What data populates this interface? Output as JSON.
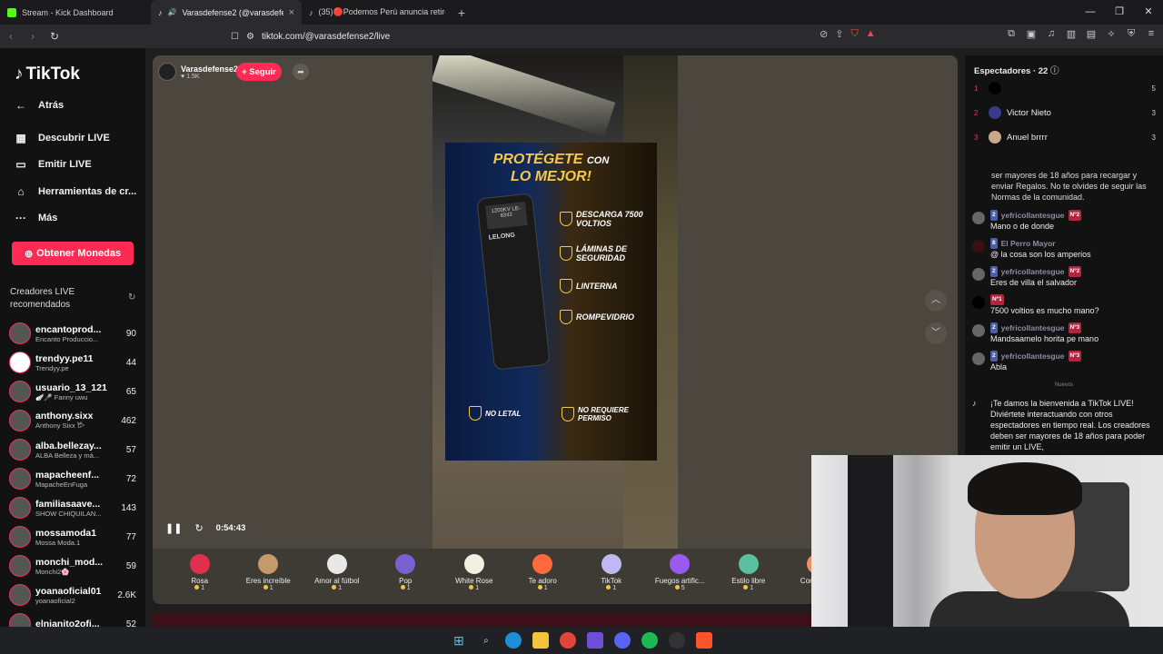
{
  "browser": {
    "tabs": [
      {
        "title": "Stream - Kick Dashboard",
        "color": "#53fc18"
      },
      {
        "title": "Varasdefense2 (@varasdefen...",
        "color": "#ffffff"
      },
      {
        "title": "(35)🔴Podemos Perú anuncia retiro c...",
        "color": "#ffffff"
      }
    ],
    "url": "tiktok.com/@varasdefense2/live"
  },
  "sidebar": {
    "logo": "TikTok",
    "items": [
      {
        "label": "Atrás",
        "icon": "←"
      },
      {
        "label": "Descubrir LIVE",
        "icon": "▦"
      },
      {
        "label": "Emitir LIVE",
        "icon": "▭"
      },
      {
        "label": "Herramientas de cr...",
        "icon": "⌂"
      },
      {
        "label": "Más",
        "icon": "···"
      }
    ],
    "coins_button": "Obtener Monedas",
    "recommended_title": "Creadores LIVE recomendados",
    "creators": [
      {
        "name": "encantoprod...",
        "sub": "Encanto Produccio...",
        "count": "90"
      },
      {
        "name": "trendyy.pe11",
        "sub": "Trendyy.pe",
        "count": "44"
      },
      {
        "name": "usuario_13_121",
        "sub": "🪽🎤 Fanny uwu",
        "count": "65"
      },
      {
        "name": "anthony.sixx",
        "sub": "Anthony Sixx 𐂂",
        "count": "462"
      },
      {
        "name": "alba.bellezay...",
        "sub": "ALBA Belleza y má...",
        "count": "57"
      },
      {
        "name": "mapacheenf...",
        "sub": "MapacheEnFuga",
        "count": "72"
      },
      {
        "name": "familiasaave...",
        "sub": "SHOW CHIQUILAN...",
        "count": "143"
      },
      {
        "name": "mossamoda1",
        "sub": "Mossa Moda.1",
        "count": "77"
      },
      {
        "name": "monchi_mod...",
        "sub": "Monchi2🌸",
        "count": "59"
      },
      {
        "name": "yoanaoficial01",
        "sub": "yoanaoficial2",
        "count": "2.6K"
      },
      {
        "name": "elnianito2ofi...",
        "sub": "",
        "count": "52"
      }
    ]
  },
  "stream": {
    "host_name": "Varasdefense2",
    "host_likes": "1.5K",
    "follow_label": "+ Seguir",
    "elapsed": "0:54:43",
    "ad": {
      "title1": "PROTÉGETE",
      "title1b": "CON",
      "title2": "LO MEJOR!",
      "device_model": "1200KV LE-8342",
      "brand": "LELONG",
      "features": [
        "DESCARGA 7500 VOLTIOS",
        "LÁMINAS DE SEGURIDAD",
        "LINTERNA",
        "ROMPEVIDRIO"
      ],
      "badges": [
        "NO LETAL",
        "NO REQUIERE PERMISO"
      ]
    },
    "gifts": [
      {
        "name": "Rosa",
        "price": "1",
        "color": "#e0304e"
      },
      {
        "name": "Eres increíble",
        "price": "1",
        "color": "#c49a6c"
      },
      {
        "name": "Amor al fútbol",
        "price": "1",
        "color": "#e8e8e8"
      },
      {
        "name": "Pop",
        "price": "1",
        "color": "#7a5fd0"
      },
      {
        "name": "White Rose",
        "price": "1",
        "color": "#f0f0e0"
      },
      {
        "name": "Te adoro",
        "price": "1",
        "color": "#ff6a3d"
      },
      {
        "name": "TikTok",
        "price": "1",
        "color": "#c0b8f0"
      },
      {
        "name": "Fuegos artific...",
        "price": "5",
        "color": "#9a5af0"
      },
      {
        "name": "Estilo libre",
        "price": "1",
        "color": "#5ac0a0"
      },
      {
        "name": "Corazón...",
        "price": "5",
        "color": "#f09060"
      }
    ]
  },
  "rightpanel": {
    "viewers_title": "Espectadores · 22",
    "viewers": [
      {
        "rank": "1",
        "name": "",
        "count": "5"
      },
      {
        "rank": "2",
        "name": "Victor Nieto",
        "count": "3"
      },
      {
        "rank": "3",
        "name": "Anuel brrrr",
        "count": "3"
      }
    ],
    "notice_top": "ser mayores de 18 años para recargar y enviar Regalos. No te olvides de seguir las Normas de la comunidad.",
    "messages": [
      {
        "level": "2",
        "user": "yefricollantesgue",
        "fan": "Nº2",
        "text": "Mano o de donde"
      },
      {
        "level": "8",
        "user": "El Perro Mayor",
        "fan": "",
        "text": "@ la cosa son los amperios"
      },
      {
        "level": "2",
        "user": "yefricollantesgue",
        "fan": "Nº2",
        "text": "Eres de villa el salvador"
      },
      {
        "level": "",
        "user": "",
        "fan": "Nº1",
        "text": "7500 voltios es mucho mano?"
      },
      {
        "level": "2",
        "user": "yefricollantesgue",
        "fan": "Nº3",
        "text": "Mandsaamelo horita pe mano"
      },
      {
        "level": "2",
        "user": "yefricollantesgue",
        "fan": "Nº3",
        "text": "Abla"
      }
    ],
    "new_label": "Nuevos",
    "welcome": "¡Te damos la bienvenida a TikTok LIVE! Diviértete interactuando con otros espectadores en tiempo real. Los creadores deben ser mayores de 18 años para poder emitir un LIVE,"
  }
}
